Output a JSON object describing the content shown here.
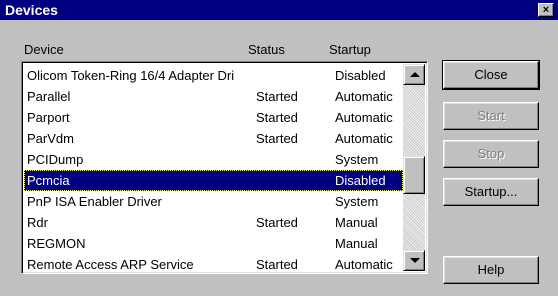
{
  "window": {
    "title": "Devices",
    "close_glyph": "×"
  },
  "columns": {
    "device": "Device",
    "status": "Status",
    "startup": "Startup"
  },
  "devices": [
    {
      "name": "Olicom Token-Ring 16/4 Adapter Dri",
      "status": "",
      "startup": "Disabled"
    },
    {
      "name": "Parallel",
      "status": "Started",
      "startup": "Automatic"
    },
    {
      "name": "Parport",
      "status": "Started",
      "startup": "Automatic"
    },
    {
      "name": "ParVdm",
      "status": "Started",
      "startup": "Automatic"
    },
    {
      "name": "PCIDump",
      "status": "",
      "startup": "System"
    },
    {
      "name": "Pcmcia",
      "status": "",
      "startup": "Disabled"
    },
    {
      "name": "PnP ISA Enabler Driver",
      "status": "",
      "startup": "System"
    },
    {
      "name": "Rdr",
      "status": "Started",
      "startup": "Manual"
    },
    {
      "name": "REGMON",
      "status": "",
      "startup": "Manual"
    },
    {
      "name": "Remote Access ARP Service",
      "status": "Started",
      "startup": "Automatic"
    }
  ],
  "selected_device": "Pcmcia",
  "buttons": {
    "close": "Close",
    "start": "Start",
    "stop": "Stop",
    "startup": "Startup...",
    "help": "Help"
  },
  "colors": {
    "title_bar": "#000080",
    "selection": "#000080",
    "face": "#c0c0c0"
  }
}
